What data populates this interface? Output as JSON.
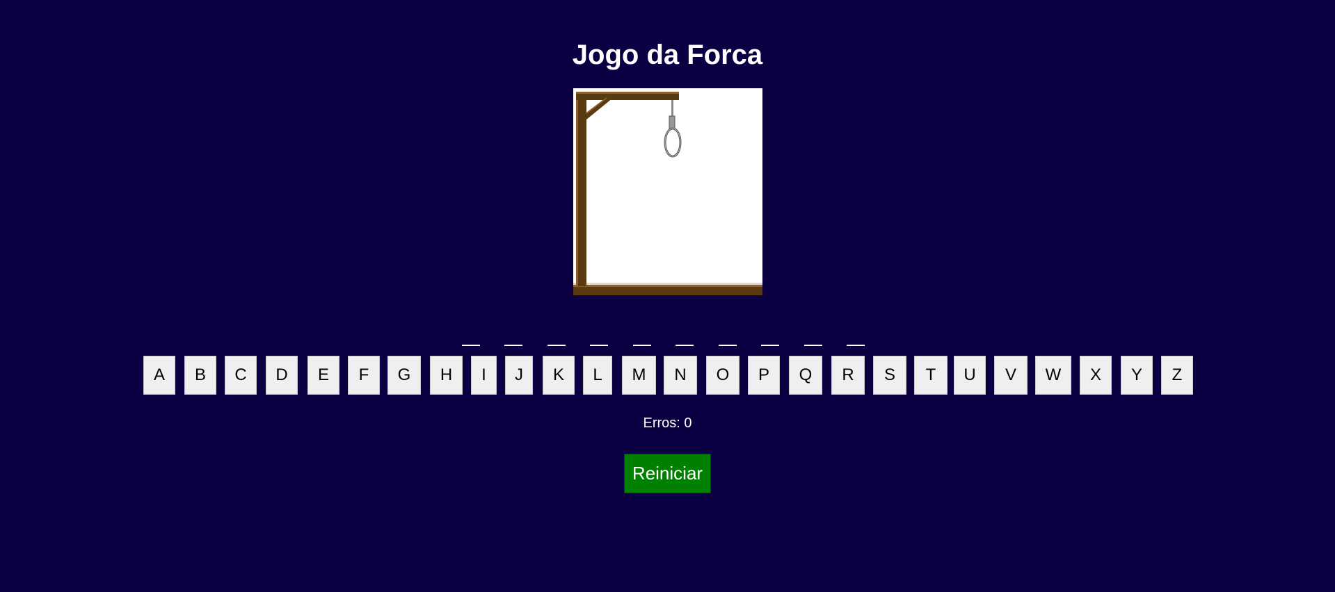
{
  "title": "Jogo da Forca",
  "gallows_image": {
    "icon": "gallows-icon",
    "colors": {
      "wood": "#5a3a10",
      "wood_highlight": "#8a6030",
      "rope": "#8a8a8a",
      "background": "#ffffff"
    }
  },
  "word": {
    "slot_count": 10,
    "revealed": [
      "",
      "",
      "",
      "",
      "",
      "",
      "",
      "",
      "",
      ""
    ]
  },
  "keyboard": {
    "keys": [
      "A",
      "B",
      "C",
      "D",
      "E",
      "F",
      "G",
      "H",
      "I",
      "J",
      "K",
      "L",
      "M",
      "N",
      "O",
      "P",
      "Q",
      "R",
      "S",
      "T",
      "U",
      "V",
      "W",
      "X",
      "Y",
      "Z"
    ]
  },
  "status": {
    "errors_text": "Erros: 0"
  },
  "restart_button": {
    "label": "Reiniciar",
    "color": "#008000"
  },
  "colors": {
    "page_background": "#0b0042",
    "key_background": "#efefef",
    "text": "#ffffff"
  }
}
